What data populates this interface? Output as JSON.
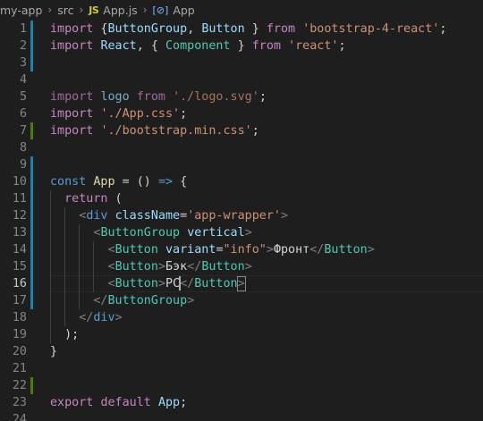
{
  "breadcrumb": {
    "project": "my-app",
    "folder": "src",
    "file_icon": "JS",
    "file": "App.js",
    "symbol_icon": "symbol-variable-icon",
    "symbol": "App"
  },
  "editor": {
    "current_line": 16,
    "lines": [
      {
        "n": "1",
        "mark": "modified",
        "tokens": [
          {
            "t": "import",
            "c": "kw"
          },
          {
            "t": " {",
            "c": "pun"
          },
          {
            "t": "ButtonGroup",
            "c": "var"
          },
          {
            "t": ", ",
            "c": "pun"
          },
          {
            "t": "Button",
            "c": "var"
          },
          {
            "t": " } ",
            "c": "pun"
          },
          {
            "t": "from",
            "c": "kw"
          },
          {
            "t": " ",
            "c": "pun"
          },
          {
            "t": "'bootstrap-4-react'",
            "c": "str"
          },
          {
            "t": ";",
            "c": "pun"
          }
        ]
      },
      {
        "n": "2",
        "mark": "modified",
        "tokens": [
          {
            "t": "import",
            "c": "kw"
          },
          {
            "t": " ",
            "c": "pun"
          },
          {
            "t": "React",
            "c": "var"
          },
          {
            "t": ", { ",
            "c": "pun"
          },
          {
            "t": "Component",
            "c": "type"
          },
          {
            "t": " } ",
            "c": "pun"
          },
          {
            "t": "from",
            "c": "kw"
          },
          {
            "t": " ",
            "c": "pun"
          },
          {
            "t": "'react'",
            "c": "str"
          },
          {
            "t": ";",
            "c": "pun"
          }
        ]
      },
      {
        "n": "3",
        "mark": "modified",
        "tokens": []
      },
      {
        "n": "4",
        "mark": "",
        "tokens": []
      },
      {
        "n": "5",
        "mark": "",
        "tokens": [
          {
            "t": "import",
            "c": "kw",
            "dim": true
          },
          {
            "t": " ",
            "c": "pun"
          },
          {
            "t": "logo",
            "c": "var",
            "dim": true
          },
          {
            "t": " ",
            "c": "pun"
          },
          {
            "t": "from",
            "c": "kw",
            "dim": true
          },
          {
            "t": " ",
            "c": "pun"
          },
          {
            "t": "'./logo.svg'",
            "c": "str",
            "dim": true
          },
          {
            "t": ";",
            "c": "pun"
          }
        ]
      },
      {
        "n": "6",
        "mark": "",
        "tokens": [
          {
            "t": "import",
            "c": "kw"
          },
          {
            "t": " ",
            "c": "pun"
          },
          {
            "t": "'./App.css'",
            "c": "str"
          },
          {
            "t": ";",
            "c": "pun"
          }
        ]
      },
      {
        "n": "7",
        "mark": "added",
        "tokens": [
          {
            "t": "import",
            "c": "kw"
          },
          {
            "t": " ",
            "c": "pun"
          },
          {
            "t": "'./bootstrap.min.css'",
            "c": "str"
          },
          {
            "t": ";",
            "c": "pun"
          }
        ]
      },
      {
        "n": "8",
        "mark": "",
        "tokens": []
      },
      {
        "n": "9",
        "mark": "modified",
        "tokens": []
      },
      {
        "n": "10",
        "mark": "modified",
        "tokens": [
          {
            "t": "const",
            "c": "decl"
          },
          {
            "t": " ",
            "c": "pun"
          },
          {
            "t": "App",
            "c": "fn"
          },
          {
            "t": " = () ",
            "c": "pun"
          },
          {
            "t": "=>",
            "c": "decl"
          },
          {
            "t": " {",
            "c": "pun"
          }
        ]
      },
      {
        "n": "11",
        "mark": "modified",
        "tokens": [
          {
            "t": "  ",
            "c": "pun"
          },
          {
            "t": "return",
            "c": "kw"
          },
          {
            "t": " (",
            "c": "pun"
          }
        ]
      },
      {
        "n": "12",
        "mark": "modified",
        "tokens": [
          {
            "t": "    ",
            "c": "pun"
          },
          {
            "t": "<",
            "c": "brk"
          },
          {
            "t": "div",
            "c": "ptag"
          },
          {
            "t": " ",
            "c": "pun"
          },
          {
            "t": "className",
            "c": "attr"
          },
          {
            "t": "=",
            "c": "pun"
          },
          {
            "t": "'app-wrapper'",
            "c": "str"
          },
          {
            "t": ">",
            "c": "brk"
          }
        ]
      },
      {
        "n": "13",
        "mark": "modified",
        "tokens": [
          {
            "t": "      ",
            "c": "pun"
          },
          {
            "t": "<",
            "c": "brk"
          },
          {
            "t": "ButtonGroup",
            "c": "tag"
          },
          {
            "t": " ",
            "c": "pun"
          },
          {
            "t": "vertical",
            "c": "attr"
          },
          {
            "t": ">",
            "c": "brk"
          }
        ]
      },
      {
        "n": "14",
        "mark": "modified",
        "tokens": [
          {
            "t": "        ",
            "c": "pun"
          },
          {
            "t": "<",
            "c": "brk"
          },
          {
            "t": "Button",
            "c": "tag"
          },
          {
            "t": " ",
            "c": "pun"
          },
          {
            "t": "variant",
            "c": "attr"
          },
          {
            "t": "=",
            "c": "pun"
          },
          {
            "t": "\"info\"",
            "c": "str"
          },
          {
            "t": ">",
            "c": "brk"
          },
          {
            "t": "Фронт",
            "c": "txt"
          },
          {
            "t": "</",
            "c": "brk"
          },
          {
            "t": "Button",
            "c": "tag"
          },
          {
            "t": ">",
            "c": "brk"
          }
        ]
      },
      {
        "n": "15",
        "mark": "modified",
        "tokens": [
          {
            "t": "        ",
            "c": "pun"
          },
          {
            "t": "<",
            "c": "brk"
          },
          {
            "t": "Button",
            "c": "tag"
          },
          {
            "t": ">",
            "c": "brk"
          },
          {
            "t": "Бэк",
            "c": "txt"
          },
          {
            "t": "</",
            "c": "brk"
          },
          {
            "t": "Button",
            "c": "tag"
          },
          {
            "t": ">",
            "c": "brk"
          }
        ]
      },
      {
        "n": "16",
        "mark": "modified",
        "cursor_after": 3,
        "tokens": [
          {
            "t": "        ",
            "c": "pun"
          },
          {
            "t": "<",
            "c": "brk"
          },
          {
            "t": "Button",
            "c": "tag"
          },
          {
            "t": ">",
            "c": "brk"
          },
          {
            "t": "PC",
            "c": "txt"
          },
          {
            "t": "</",
            "c": "brk"
          },
          {
            "t": "Button",
            "c": "tag"
          },
          {
            "t": ">",
            "c": "brk",
            "match": true
          }
        ]
      },
      {
        "n": "17",
        "mark": "modified",
        "tokens": [
          {
            "t": "      ",
            "c": "pun"
          },
          {
            "t": "</",
            "c": "brk"
          },
          {
            "t": "ButtonGroup",
            "c": "tag"
          },
          {
            "t": ">",
            "c": "brk"
          }
        ]
      },
      {
        "n": "18",
        "mark": "",
        "tokens": [
          {
            "t": "    ",
            "c": "pun"
          },
          {
            "t": "</",
            "c": "brk"
          },
          {
            "t": "div",
            "c": "ptag"
          },
          {
            "t": ">",
            "c": "brk"
          }
        ]
      },
      {
        "n": "19",
        "mark": "",
        "tokens": [
          {
            "t": "  ",
            "c": "pun"
          },
          {
            "t": ");",
            "c": "pun"
          }
        ]
      },
      {
        "n": "20",
        "mark": "",
        "tokens": [
          {
            "t": "}",
            "c": "pun"
          }
        ]
      },
      {
        "n": "21",
        "mark": "",
        "tokens": []
      },
      {
        "n": "22",
        "mark": "added",
        "tokens": []
      },
      {
        "n": "23",
        "mark": "",
        "tokens": [
          {
            "t": "export",
            "c": "kw"
          },
          {
            "t": " ",
            "c": "pun"
          },
          {
            "t": "default",
            "c": "kw"
          },
          {
            "t": " ",
            "c": "pun"
          },
          {
            "t": "App",
            "c": "var"
          },
          {
            "t": ";",
            "c": "pun"
          }
        ]
      },
      {
        "n": "24",
        "mark": "",
        "tokens": []
      }
    ]
  },
  "colors": {
    "background": "#1e1e1e",
    "gutter_modified": "#1b81a8",
    "gutter_added": "#487e02"
  }
}
